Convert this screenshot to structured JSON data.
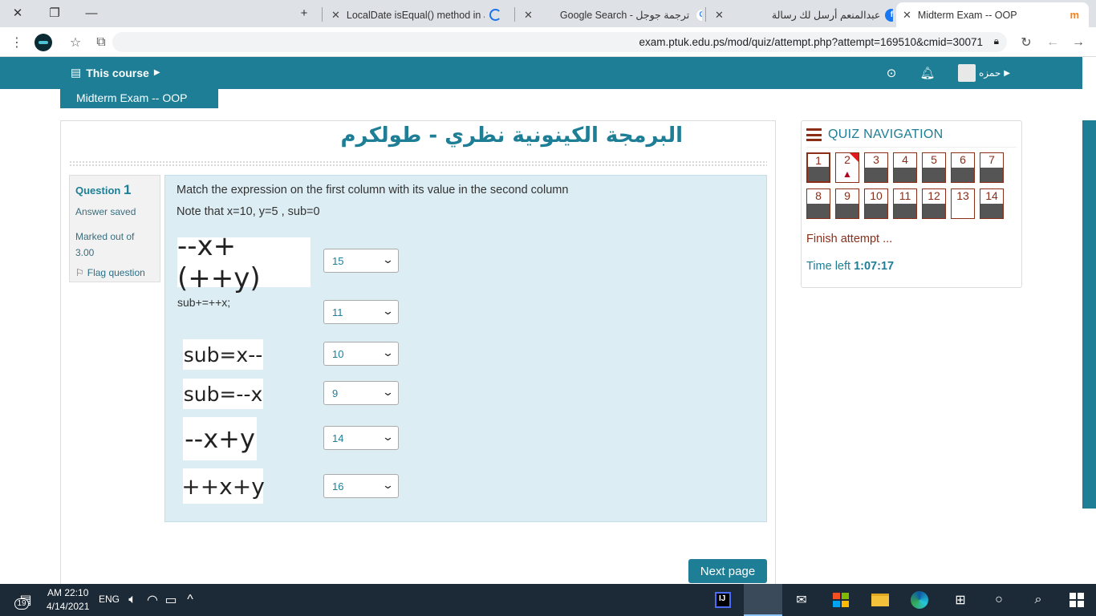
{
  "browser": {
    "tabs": [
      {
        "title": "LocalDate isEqual() method in Ja",
        "favicon": "loading-spinner-icon"
      },
      {
        "title": "Google Search - ترجمة جوجل",
        "favicon": "google-icon"
      },
      {
        "title": "عبدالمنعم أرسل لك رسالة",
        "favicon": "facebook-icon"
      },
      {
        "title": "Midterm Exam -- OOP",
        "favicon": "moodle-icon",
        "active": true
      }
    ],
    "url": "exam.ptuk.edu.ps/mod/quiz/attempt.php?attempt=169510&cmid=30071"
  },
  "navbar": {
    "course_menu": "This course",
    "user_name": "حمزه"
  },
  "breadcrumb": "Midterm Exam -- OOP",
  "page_title": "البرمجة الكينونية نظري - طولكرم",
  "question_info": {
    "label": "Question",
    "number": "1",
    "state": "Answer saved",
    "marked": "Marked out of 3.00",
    "flag": "Flag question"
  },
  "question": {
    "text": "Match the expression on the first column with its value in the second column",
    "note": "Note that x=10, y=5 , sub=0",
    "rows": [
      {
        "expr": "--x+(++y)",
        "answer": "15"
      },
      {
        "expr": "sub+=++x;",
        "answer": "11"
      },
      {
        "expr": "sub=x--",
        "answer": "10"
      },
      {
        "expr": "sub=--x",
        "answer": "9"
      },
      {
        "expr": "--x+y",
        "answer": "14"
      },
      {
        "expr": "++x+y",
        "answer": "16"
      }
    ]
  },
  "next_button": "Next page",
  "quiz_nav": {
    "title": "QUIZ NAVIGATION",
    "buttons": [
      "1",
      "2",
      "3",
      "4",
      "5",
      "6",
      "7",
      "8",
      "9",
      "10",
      "11",
      "12",
      "13",
      "14"
    ],
    "finish": "Finish attempt ...",
    "time_label": "Time left",
    "time_value": "1:07:17"
  },
  "taskbar": {
    "time": "AM 22:10",
    "date": "4/14/2021",
    "lang": "ENG",
    "notifications": "19"
  }
}
